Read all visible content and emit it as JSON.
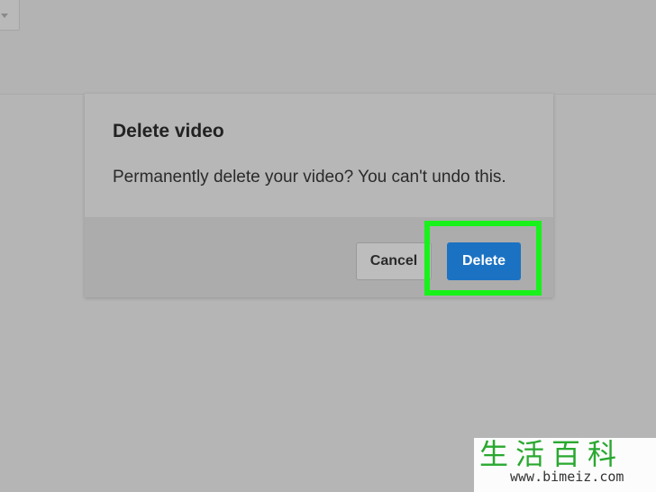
{
  "dialog": {
    "title": "Delete video",
    "message": "Permanently delete your video? You can't undo this.",
    "cancel_label": "Cancel",
    "delete_label": "Delete"
  },
  "watermark": {
    "chinese": "生活百科",
    "url": "www.bimeiz.com"
  },
  "colors": {
    "overlay": "#b5b5b5",
    "primary_button": "#1b72c2",
    "highlight": "#18f21a"
  }
}
